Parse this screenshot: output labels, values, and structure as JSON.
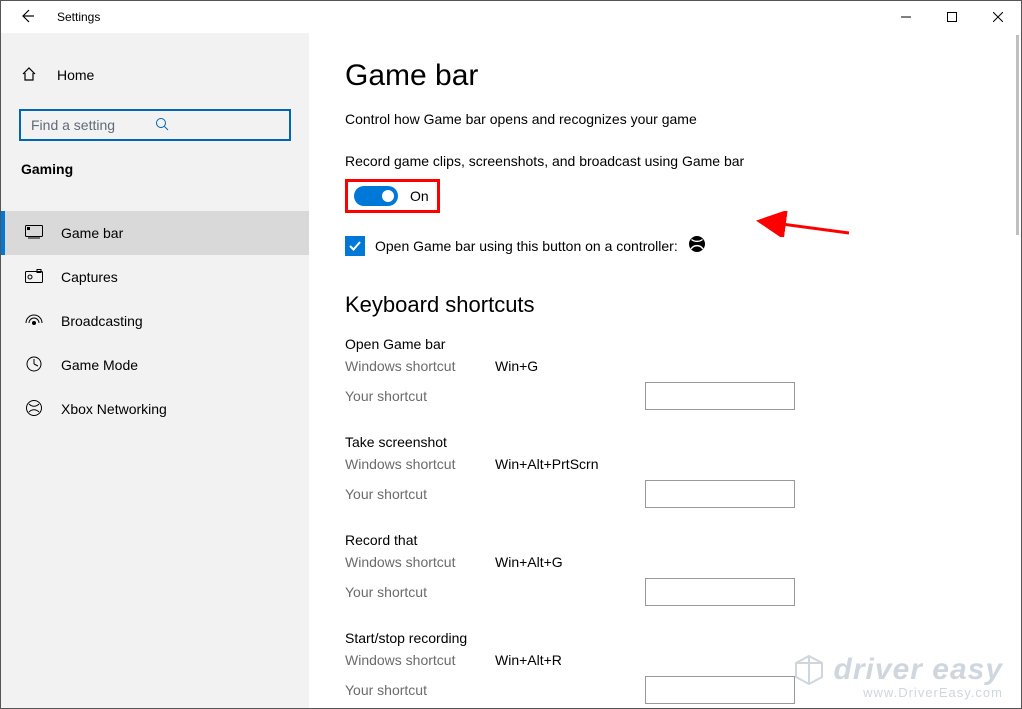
{
  "window": {
    "title": "Settings"
  },
  "sidebar": {
    "home": "Home",
    "search_placeholder": "Find a setting",
    "section": "Gaming",
    "items": [
      {
        "label": "Game bar"
      },
      {
        "label": "Captures"
      },
      {
        "label": "Broadcasting"
      },
      {
        "label": "Game Mode"
      },
      {
        "label": "Xbox Networking"
      }
    ]
  },
  "main": {
    "title": "Game bar",
    "subtitle": "Control how Game bar opens and recognizes your game",
    "toggle_label": "Record game clips, screenshots, and broadcast using Game bar",
    "toggle_state": "On",
    "checkbox_label": "Open Game bar using this button on a controller:",
    "keyboard_heading": "Keyboard shortcuts",
    "ws_label": "Windows shortcut",
    "ys_label": "Your shortcut",
    "shortcuts": [
      {
        "name": "Open Game bar",
        "ws": "Win+G"
      },
      {
        "name": "Take screenshot",
        "ws": "Win+Alt+PrtScrn"
      },
      {
        "name": "Record that",
        "ws": "Win+Alt+G"
      },
      {
        "name": "Start/stop recording",
        "ws": "Win+Alt+R"
      }
    ]
  },
  "watermark": {
    "brand": "driver easy",
    "url": "www.DriverEasy.com"
  }
}
